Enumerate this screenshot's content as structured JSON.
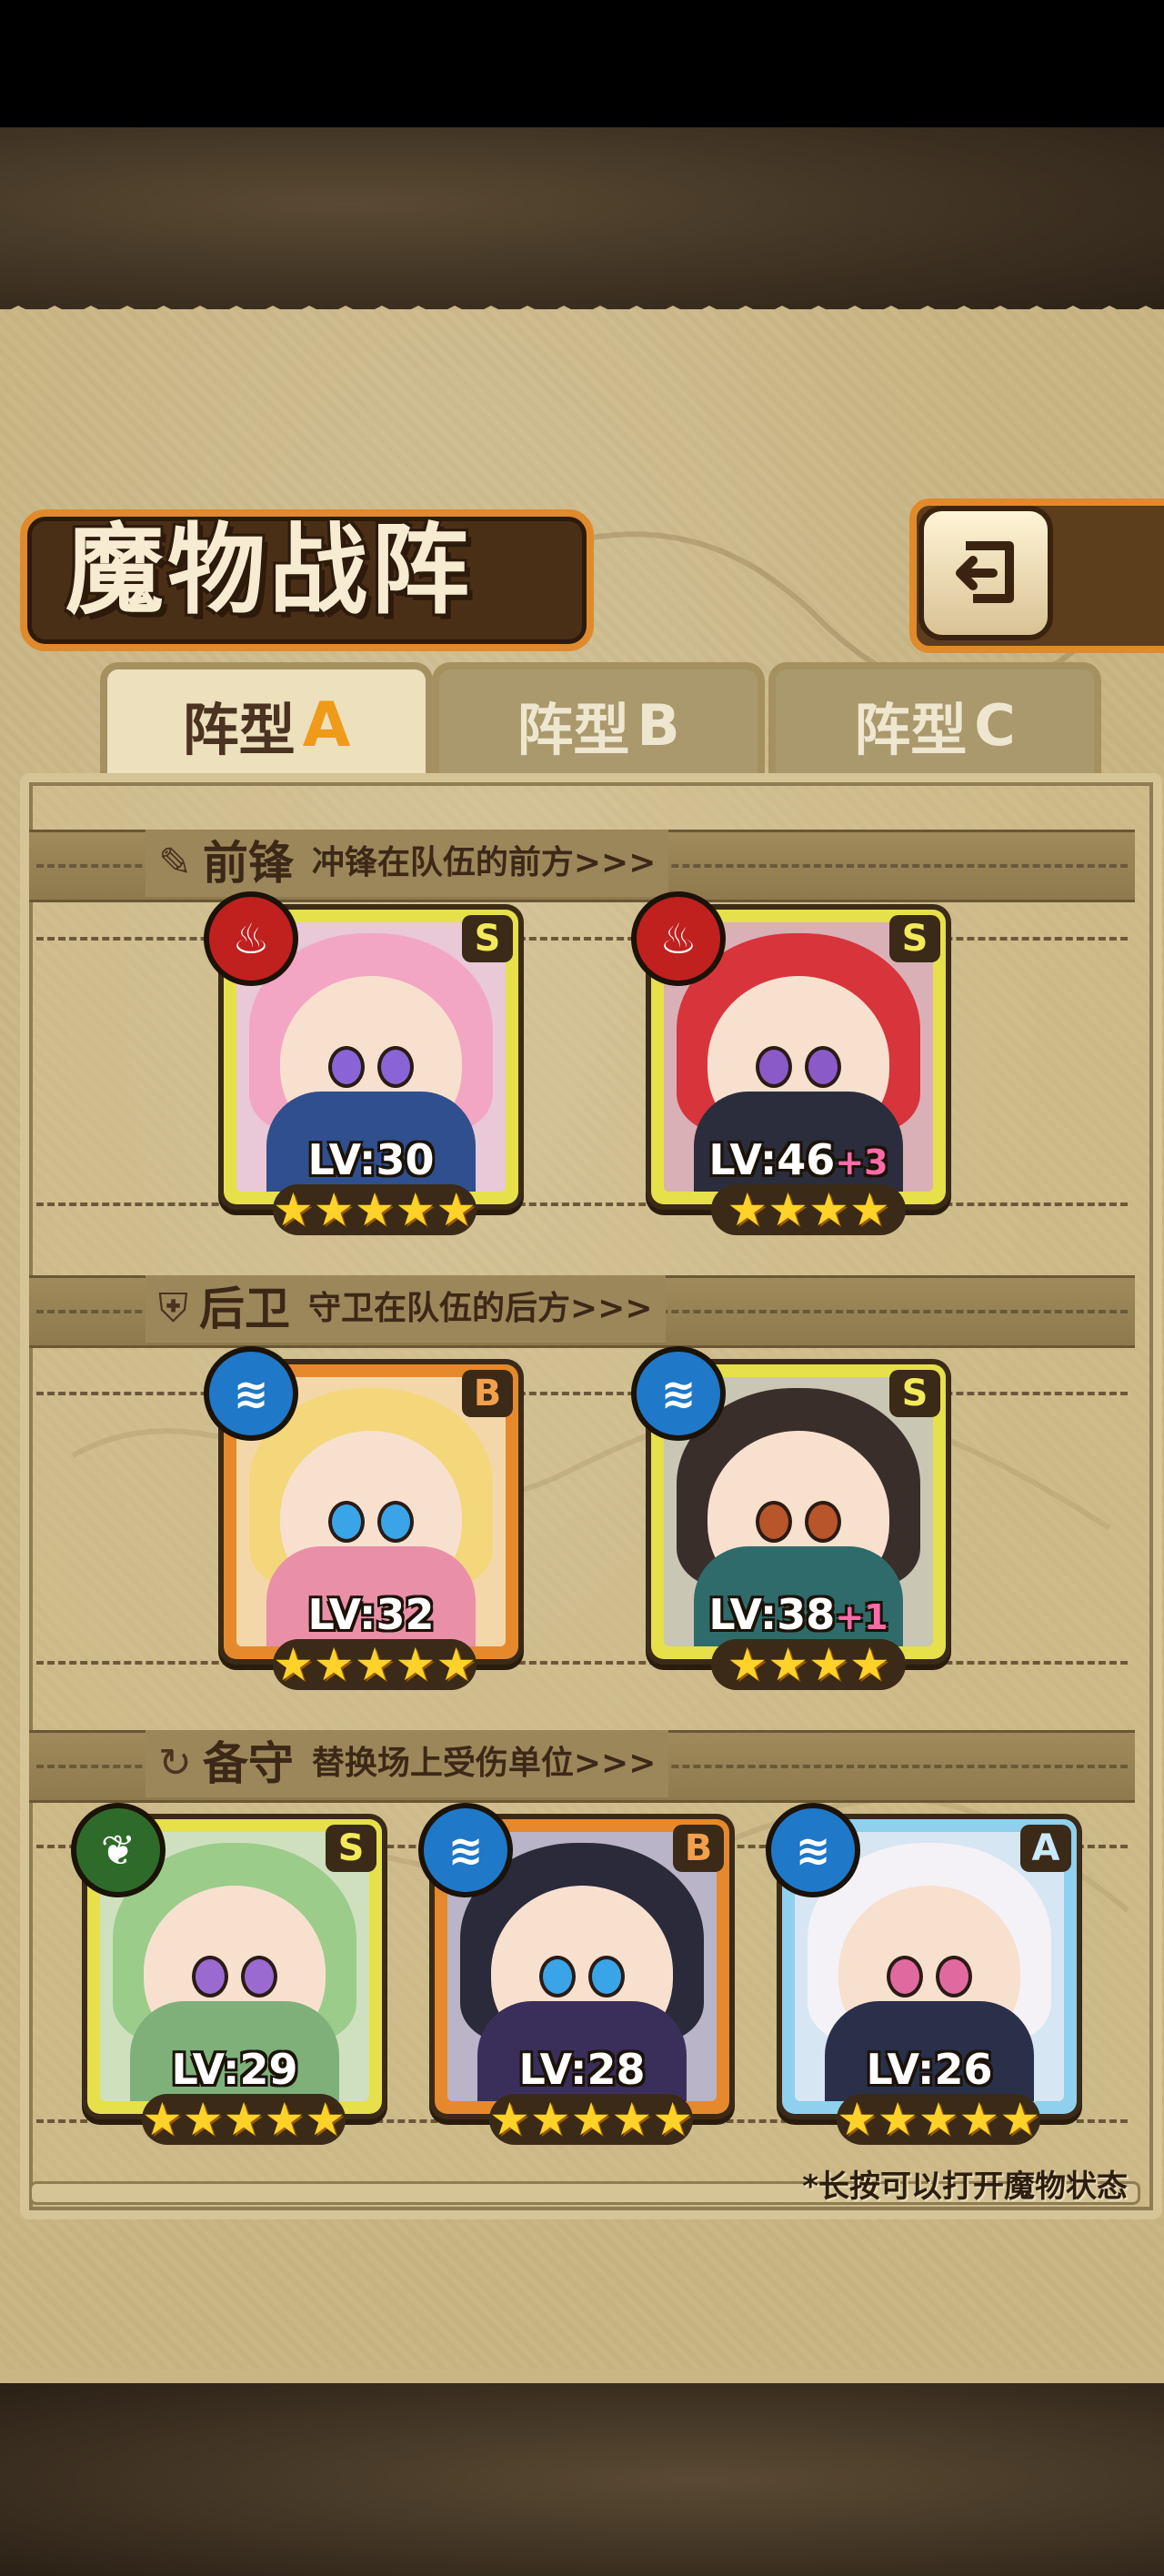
{
  "title": "魔物战阵",
  "tabs": [
    {
      "label": "阵型",
      "letter": "A",
      "active": true
    },
    {
      "label": "阵型",
      "letter": "B",
      "active": false
    },
    {
      "label": "阵型",
      "letter": "C",
      "active": false
    }
  ],
  "sections": {
    "front": {
      "icon": "sword-icon",
      "title": "前锋",
      "desc": "冲锋在队伍的前方>>>"
    },
    "rear": {
      "icon": "shield-icon",
      "title": "后卫",
      "desc": "守卫在队伍的后方>>>"
    },
    "reserve": {
      "icon": "swap-icon",
      "title": "备守",
      "desc": "替换场上受伤单位>>>"
    }
  },
  "cards": {
    "front": [
      {
        "rank": "S",
        "element": "fire",
        "level": "LV:30",
        "plus": "",
        "stars": 5
      },
      {
        "rank": "S",
        "element": "fire",
        "level": "LV:46",
        "plus": "+3",
        "stars": 4
      }
    ],
    "rear": [
      {
        "rank": "B",
        "element": "water",
        "level": "LV:32",
        "plus": "",
        "stars": 5
      },
      {
        "rank": "S",
        "element": "water",
        "level": "LV:38",
        "plus": "+1",
        "stars": 4
      }
    ],
    "reserve": [
      {
        "rank": "S",
        "element": "grass",
        "level": "LV:29",
        "plus": "",
        "stars": 5
      },
      {
        "rank": "B",
        "element": "water",
        "level": "LV:28",
        "plus": "",
        "stars": 5
      },
      {
        "rank": "A",
        "element": "water",
        "level": "LV:26",
        "plus": "",
        "stars": 5
      }
    ]
  },
  "hint": "*长按可以打开魔物状态",
  "colors": {
    "accent": "#e08a2c",
    "parchment": "#c9b684",
    "star": "#ffd22a",
    "fire": "#c0201e",
    "water": "#1f78c8",
    "grass": "#2e6b2a"
  }
}
